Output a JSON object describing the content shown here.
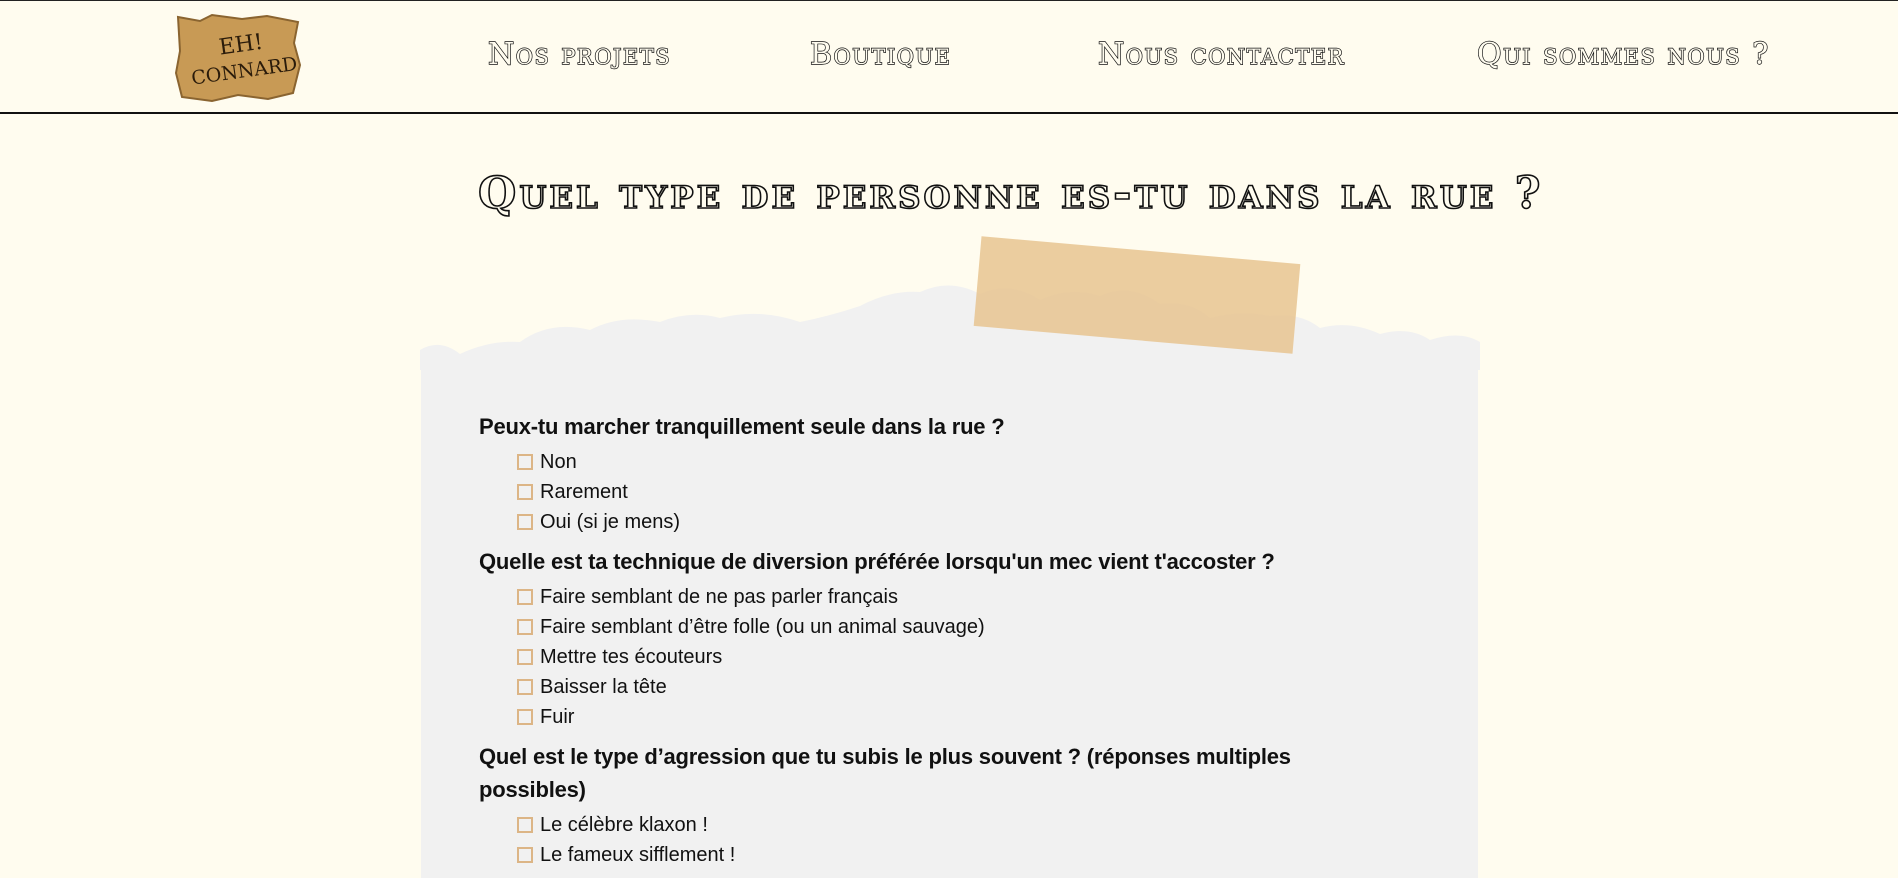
{
  "header": {
    "logo": {
      "text": "Eh! Connard",
      "icon": "cardboard-logo-icon"
    },
    "nav": [
      {
        "label": "Nos projets"
      },
      {
        "label": "Boutique"
      },
      {
        "label": "Nous contacter"
      },
      {
        "label": "Qui sommes nous ?"
      }
    ]
  },
  "page": {
    "title": "Quel type de personne es-tu dans la rue ?"
  },
  "quiz": {
    "questions": [
      {
        "text": "Peux-tu marcher tranquillement seule dans la rue ?",
        "options": [
          "Non",
          "Rarement",
          "Oui (si je mens)"
        ]
      },
      {
        "text": "Quelle est ta technique de diversion préférée lorsqu'un mec vient t'accoster ?",
        "options": [
          "Faire semblant de ne pas parler français",
          "Faire semblant d’être folle (ou un animal sauvage)",
          "Mettre tes écouteurs",
          "Baisser la tête",
          "Fuir"
        ]
      },
      {
        "text": "Quel est le type d’agression que tu subis le plus souvent ? (réponses multiples possibles)",
        "options": [
          "Le célèbre klaxon !",
          "Le fameux sifflement !"
        ]
      }
    ]
  },
  "colors": {
    "background": "#fffcef",
    "paper": "#f1f1f1",
    "tape": "#e7c491",
    "checkbox_border": "#dcb586"
  }
}
